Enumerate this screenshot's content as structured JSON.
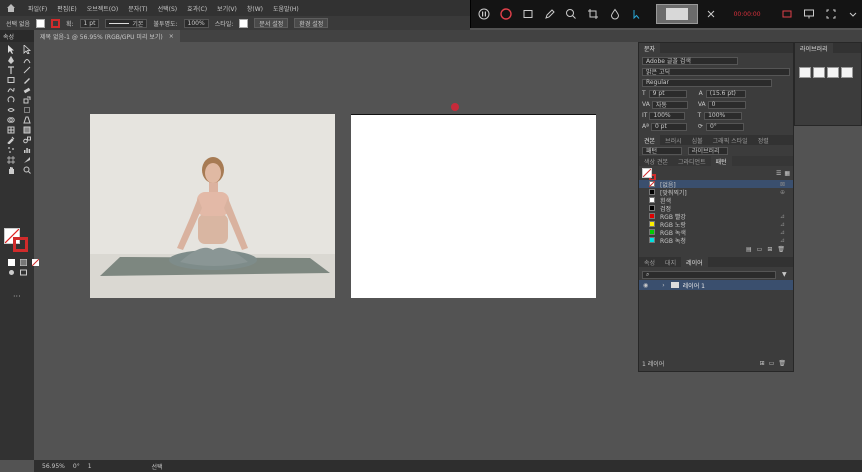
{
  "menubar": {
    "items": [
      "파일(F)",
      "편집(E)",
      "오브젝트(O)",
      "문자(T)",
      "선택(S)",
      "효과(C)",
      "보기(V)",
      "창(W)",
      "도움말(H)"
    ]
  },
  "capture_bar": {
    "rec_label": "00:00:00"
  },
  "controlbar": {
    "selection_label": "선택 없음",
    "stroke_label": "획:",
    "stroke_weight": "1 pt",
    "brush_label": "기본",
    "opacity_label": "불투명도:",
    "opacity_value": "100%",
    "style_label": "스타일:",
    "doc_setup_button": "문서 설정",
    "prefs_button": "환경 설정"
  },
  "doc_tab": {
    "title": "제목 없음-1 @ 56.95% (RGB/GPU 미리 보기)"
  },
  "tools": {
    "header": "속성"
  },
  "char_panel": {
    "tab": "문자",
    "search_placeholder": "Adobe 글꼴 검색",
    "font_family": "맑은 고딕",
    "font_style": "Regular",
    "size_label": "9 pt",
    "leading_label": "(15.6 pt)",
    "tracking_label": "0",
    "kern_label": "자동",
    "h_scale": "100%",
    "v_scale": "100%",
    "baseline": "0 pt",
    "rotation": "0°",
    "tsume": "0%"
  },
  "swatch_panel": {
    "tabs": [
      "견본",
      "브러시",
      "심볼",
      "그래픽 스타일",
      "정렬"
    ],
    "sub_tabs": [
      "색상 견본",
      "그라디언트",
      "패턴"
    ],
    "header_labels": [
      "패턴",
      "라이브러리"
    ],
    "items": [
      {
        "name": "[없음]",
        "color": "#ffffff",
        "selected": true
      },
      {
        "name": "[맞춰찍기]",
        "color": "#000000",
        "selected": false
      },
      {
        "name": "흰색",
        "color": "#ffffff",
        "selected": false
      },
      {
        "name": "검정",
        "color": "#000000",
        "selected": false
      },
      {
        "name": "RGB 빨강",
        "color": "#e00000",
        "selected": false
      },
      {
        "name": "RGB 노랑",
        "color": "#ffee00",
        "selected": false
      },
      {
        "name": "RGB 녹색",
        "color": "#00cc00",
        "selected": false
      },
      {
        "name": "RGB 녹청",
        "color": "#00e0e0",
        "selected": false
      }
    ]
  },
  "layers_panel": {
    "tabs": [
      "속성",
      "레이어",
      "대지"
    ],
    "active_tab": "레이어",
    "layer_name": "레이어 1",
    "footer_label": "1 레이어"
  },
  "libraries": {
    "tab": "라이브러리"
  },
  "statusbar": {
    "zoom": "56.95%",
    "rotation": "0°",
    "artboard_index": "1",
    "tool_label": "선택"
  },
  "colors": {
    "accent": "#3a4f6e",
    "stroke_red": "#d12b2b",
    "rec_red": "#d8303c"
  }
}
